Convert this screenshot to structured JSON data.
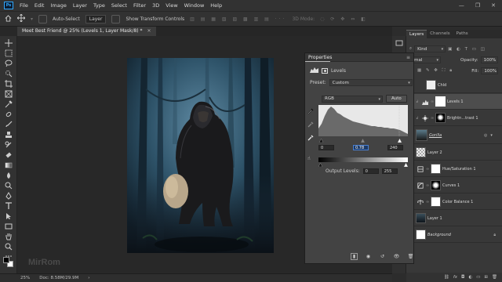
{
  "app": {
    "logo": "Ps",
    "menu": [
      "File",
      "Edit",
      "Image",
      "Layer",
      "Type",
      "Select",
      "Filter",
      "3D",
      "View",
      "Window",
      "Help"
    ],
    "window_controls": [
      "—",
      "❐",
      "✕"
    ]
  },
  "options": {
    "auto_select_label": "Auto-Select",
    "auto_select_target": "Layer",
    "transform_controls_label": "Show Transform Controls",
    "mode_3d_label": "3D Mode:"
  },
  "document": {
    "tab_title": "Meet Best Friend @ 25% (Levels 1, Layer Mask/8) *",
    "zoom": "25%",
    "doc_size": "Doc: 8.58M/29.9M",
    "watermark": "MirRom"
  },
  "properties": {
    "title": "Properties",
    "adjustment_name": "Levels",
    "preset_label": "Preset:",
    "preset_value": "Custom",
    "channel_value": "RGB",
    "auto_label": "Auto",
    "input_black": "0",
    "input_gamma": "0.78",
    "input_white": "240",
    "output_label": "Output Levels:",
    "output_black": "0",
    "output_white": "255"
  },
  "layers_panel": {
    "tabs": [
      "Layers",
      "Channels",
      "Paths"
    ],
    "kind_label": "Kind",
    "blend_mode": "rmal",
    "opacity_label": "Opacity:",
    "opacity_value": "100%",
    "fill_label": "Fill:",
    "fill_value": "100%",
    "layers": [
      {
        "name": "Chld",
        "type": "pixel",
        "visible": false,
        "active": false
      },
      {
        "name": "Levels 1",
        "type": "levels",
        "visible": false,
        "active": true
      },
      {
        "name": "Brightn...trast 1",
        "type": "brightness",
        "visible": false,
        "active": false
      },
      {
        "name": "Gorilla",
        "type": "smart",
        "visible": false,
        "active": false
      },
      {
        "name": "Layer 2",
        "type": "pixel",
        "visible": false,
        "active": false
      },
      {
        "name": "Hue/Saturation 1",
        "type": "hue",
        "visible": true,
        "active": false
      },
      {
        "name": "Curves 1",
        "type": "curves",
        "visible": true,
        "active": false
      },
      {
        "name": "Color Balance 1",
        "type": "colorbalance",
        "visible": true,
        "active": false
      },
      {
        "name": "Layer 1",
        "type": "pixel",
        "visible": true,
        "active": false
      },
      {
        "name": "Background",
        "type": "background",
        "visible": true,
        "active": false
      }
    ],
    "bottom_icons": [
      "link-icon",
      "fx-icon",
      "mask-icon",
      "adjustment-icon",
      "folder-icon",
      "new-layer-icon",
      "trash-icon"
    ]
  },
  "colors": {
    "accent": "#31a8ff",
    "panel": "#434343",
    "layer_active": "#4d4d4d"
  }
}
